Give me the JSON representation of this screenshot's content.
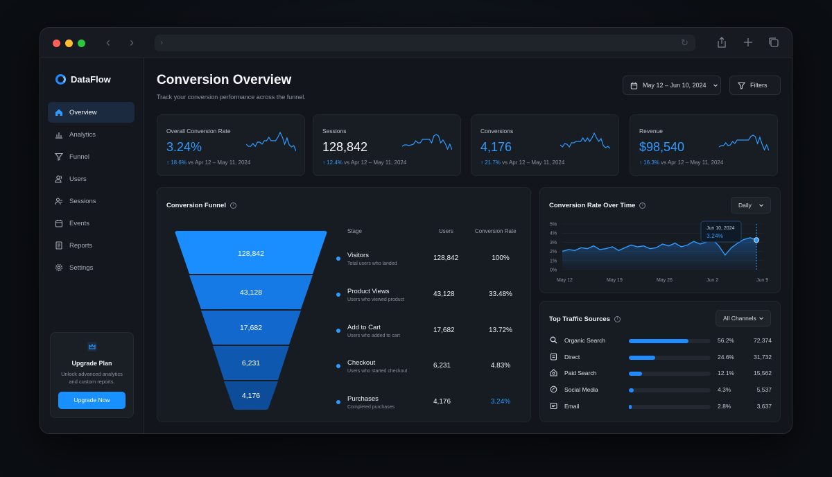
{
  "app": {
    "name": "DataFlow"
  },
  "colors": {
    "accent": "#1e8bff",
    "accent_light": "#2e9bff",
    "background": "#12151b"
  },
  "sidebar": {
    "items": [
      {
        "label": "Overview",
        "icon": "home-icon",
        "active": true
      },
      {
        "label": "Analytics",
        "icon": "bar-chart-icon"
      },
      {
        "label": "Funnel",
        "icon": "funnel-icon"
      },
      {
        "label": "Users",
        "icon": "users-icon"
      },
      {
        "label": "Sessions",
        "icon": "sessions-icon"
      },
      {
        "label": "Events",
        "icon": "calendar-icon"
      },
      {
        "label": "Reports",
        "icon": "document-icon"
      },
      {
        "label": "Settings",
        "icon": "gear-icon"
      }
    ],
    "upgrade": {
      "title": "Upgrade Plan",
      "desc": "Unlock advanced analytics and custom reports.",
      "button": "Upgrade Now"
    }
  },
  "header": {
    "title": "Conversion Overview",
    "subtitle": "Track your conversion performance across the funnel.",
    "date_range": "May 12 – Jun 10, 2024",
    "filters": "Filters"
  },
  "kpis": [
    {
      "label": "Overall Conversion Rate",
      "value": "3.24%",
      "delta": "18.6%",
      "compare": "vs Apr 12 – May 11, 2024"
    },
    {
      "label": "Sessions",
      "value": "128,842",
      "delta": "12.4%",
      "compare": "vs Apr 12 – May 11, 2024"
    },
    {
      "label": "Conversions",
      "value": "4,176",
      "delta": "21.7%",
      "compare": "vs Apr 12 – May 11, 2024"
    },
    {
      "label": "Revenue",
      "value": "$98,540",
      "delta": "16.3%",
      "compare": "vs Apr 12 – May 11, 2024"
    }
  ],
  "funnel": {
    "title": "Conversion Funnel",
    "headers": {
      "stage": "Stage",
      "users": "Users",
      "rate": "Conversion Rate"
    },
    "stages": [
      {
        "name": "Visitors",
        "desc": "Total users who landed",
        "users": "128,842",
        "rate": "100%"
      },
      {
        "name": "Product Views",
        "desc": "Users who viewed product",
        "users": "43,128",
        "rate": "33.48%"
      },
      {
        "name": "Add to Cart",
        "desc": "Users who added to cart",
        "users": "17,682",
        "rate": "13.72%"
      },
      {
        "name": "Checkout",
        "desc": "Users who started checkout",
        "users": "6,231",
        "rate": "4.83%"
      },
      {
        "name": "Purchases",
        "desc": "Completed purchases",
        "users": "4,176",
        "rate": "3.24%"
      }
    ]
  },
  "rate_chart": {
    "title": "Conversion Rate Over Time",
    "period": "Daily",
    "tooltip_date": "Jun 10, 2024",
    "tooltip_value": "3.24%",
    "chart_data": {
      "type": "line",
      "x_ticks": [
        "May 12",
        "May 19",
        "May 26",
        "Jun 2",
        "Jun 9"
      ],
      "y_ticks": [
        "5%",
        "4%",
        "3%",
        "2%",
        "1%",
        "0%"
      ],
      "ylim": [
        0,
        5
      ],
      "values": [
        2.0,
        2.2,
        2.1,
        2.4,
        2.3,
        2.6,
        2.2,
        2.3,
        2.5,
        2.1,
        2.4,
        2.7,
        2.5,
        2.6,
        2.3,
        2.4,
        2.8,
        2.6,
        2.9,
        2.5,
        2.7,
        3.1,
        2.8,
        3.0,
        3.3,
        2.6,
        1.6,
        2.4,
        2.9,
        3.3,
        3.5,
        3.24
      ]
    }
  },
  "traffic": {
    "title": "Top Traffic Sources",
    "channel": "All Channels",
    "sources": [
      {
        "name": "Organic Search",
        "icon": "search-icon",
        "pct": "56.2%",
        "share": 0.562,
        "value": "72,374"
      },
      {
        "name": "Direct",
        "icon": "direct-icon",
        "pct": "24.6%",
        "share": 0.246,
        "value": "31,732"
      },
      {
        "name": "Paid Search",
        "icon": "paid-icon",
        "pct": "12.1%",
        "share": 0.121,
        "value": "15,562"
      },
      {
        "name": "Social Media",
        "icon": "social-icon",
        "pct": "4.3%",
        "share": 0.043,
        "value": "5,537"
      },
      {
        "name": "Email",
        "icon": "email-icon",
        "pct": "2.8%",
        "share": 0.028,
        "value": "3,637"
      }
    ]
  }
}
